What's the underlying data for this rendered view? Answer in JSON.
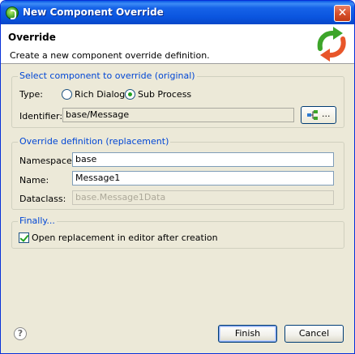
{
  "window": {
    "title": "New Component Override"
  },
  "header": {
    "title": "Override",
    "description": "Create a new component override definition."
  },
  "original_group": {
    "title": "Select component to override (original)",
    "type_label": "Type:",
    "radio_rich_dialog": "Rich Dialog",
    "radio_sub_process": "Sub Process",
    "selected_type": "Sub Process",
    "identifier_label": "Identifier:",
    "identifier_value": "base/Message",
    "browse_label": "..."
  },
  "replacement_group": {
    "title": "Override definition (replacement)",
    "namespace_label": "Namespace:",
    "namespace_value": "base",
    "name_label": "Name:",
    "name_value": "Message1",
    "dataclass_label": "Dataclass:",
    "dataclass_value": "base.Message1Data"
  },
  "finally_group": {
    "title": "Finally...",
    "open_editor_label": "Open replacement in editor after creation",
    "open_editor_checked": true
  },
  "buttons": {
    "finish": "Finish",
    "cancel": "Cancel",
    "help_glyph": "?"
  },
  "icons": {
    "app": "eclipse-app-icon",
    "close": "close-icon",
    "wizard": "override-arrows-icon",
    "browse": "component-tree-icon",
    "help": "help-icon"
  },
  "colors": {
    "group_title": "#0046d5",
    "titlebar": "#0a55df",
    "close": "#d8512c"
  }
}
